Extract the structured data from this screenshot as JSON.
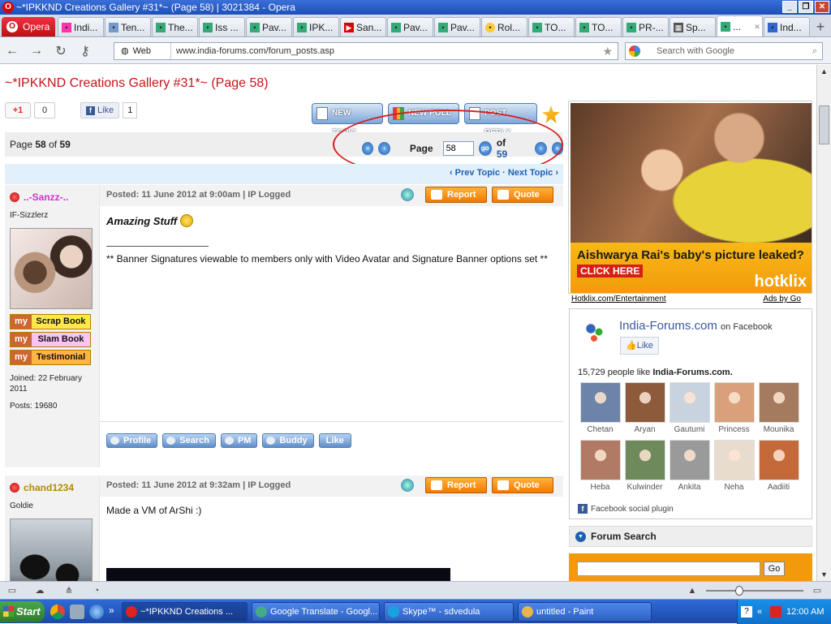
{
  "window": {
    "title": "~*IPKKND Creations Gallery #31*~ (Page 58) | 3021384 - Opera",
    "logo": "O"
  },
  "tabs": {
    "menu_label": "Opera",
    "items": [
      {
        "label": "Indi..."
      },
      {
        "label": "Ten..."
      },
      {
        "label": "The..."
      },
      {
        "label": "Iss ..."
      },
      {
        "label": "Pav..."
      },
      {
        "label": "IPK..."
      },
      {
        "label": "San..."
      },
      {
        "label": "Pav..."
      },
      {
        "label": "Pav..."
      },
      {
        "label": "Rol..."
      },
      {
        "label": "TO..."
      },
      {
        "label": "TO..."
      },
      {
        "label": "PR-..."
      },
      {
        "label": "Sp..."
      },
      {
        "label": "..."
      },
      {
        "label": "Ind..."
      }
    ]
  },
  "address": {
    "web_label": "Web",
    "url": "www.india-forums.com/forum_posts.asp",
    "search_placeholder": "Search with Google"
  },
  "page": {
    "title": "~*IPKKND Creations Gallery #31*~ (Page 58)",
    "gplus_label": "+1",
    "gplus_count": "0",
    "fb_like_label": "Like",
    "fb_like_count": "1",
    "buttons": {
      "new_topic": "NEW TOPIC",
      "new_poll": "NEW POLL",
      "post_reply": "POST REPLY"
    },
    "pagination": {
      "page_prefix": "Page",
      "current": "58",
      "of_label": "of",
      "total": "59",
      "label": "Page",
      "input_value": "58",
      "go_label": "go",
      "of_text": "of"
    },
    "topic_nav": "‹ Prev Topic · Next Topic ›"
  },
  "posts": [
    {
      "username": "..-Sanzz-..",
      "username_color": "#cc33cc",
      "rank": "IF-Sizzlerz",
      "header": "Posted: 11 June 2012 at 9:00am | IP Logged",
      "report_label": "Report",
      "quote_label": "Quote",
      "my_prefix": "my",
      "scrapbook": "Scrap Book",
      "slambook": "Slam Book",
      "testimonial": "Testimonial",
      "joined": "Joined: 22 February 2011",
      "posts": "Posts: 19680",
      "title": "Amazing Stuff",
      "signature_note": "** Banner Signatures viewable to members only with Video Avatar and Signature Banner options set **",
      "actions": {
        "profile": "Profile",
        "search": "Search",
        "pm": "PM",
        "buddy": "Buddy",
        "like": "Like"
      }
    },
    {
      "username": "chand1234",
      "username_color": "#b38a00",
      "rank": "Goldie",
      "header": "Posted: 11 June 2012 at 9:32am | IP Logged",
      "report_label": "Report",
      "quote_label": "Quote",
      "text": "Made a VM of ArShi :)"
    }
  ],
  "ad": {
    "headline": "Aishwarya Rai's baby's picture leaked?",
    "click_label": "CLICK HERE",
    "brand": "hotklix",
    "source_link": "Hotklix.com/Entertainment",
    "ads_by": "Ads by Go"
  },
  "facebook": {
    "page_name": "India-Forums.com",
    "on_facebook": "on Facebook",
    "like_label": "Like",
    "count_text": "15,729 people like",
    "count_name": "India-Forums.com.",
    "people": [
      {
        "name": "Chetan",
        "color": "#6b84a8"
      },
      {
        "name": "Aryan",
        "color": "#8d5a3c"
      },
      {
        "name": "Gautumi",
        "color": "#c9d2df"
      },
      {
        "name": "Princess",
        "color": "#d9a07c"
      },
      {
        "name": "Mounika",
        "color": "#a47b5e"
      },
      {
        "name": "Heba",
        "color": "#b07a64"
      },
      {
        "name": "Kulwinder",
        "color": "#6e8a5a"
      },
      {
        "name": "Ankita",
        "color": "#9a9a9a"
      },
      {
        "name": "Neha",
        "color": "#e8dccf"
      },
      {
        "name": "Aadiiti",
        "color": "#c46a3a"
      }
    ],
    "plugin_label": "Facebook social plugin"
  },
  "forum_search": {
    "title": "Forum Search",
    "go_label": "Go"
  },
  "taskbar": {
    "start_label": "Start",
    "tasks": [
      {
        "label": "~*IPKKND Creations ...",
        "color": "#d22"
      },
      {
        "label": "Google Translate - Googl...",
        "color": "#4a8"
      },
      {
        "label": "Skype™ - sdvedula",
        "color": "#1aa1e1"
      },
      {
        "label": "untitled - Paint",
        "color": "#e9b44c"
      }
    ],
    "clock": "12:00 AM"
  }
}
